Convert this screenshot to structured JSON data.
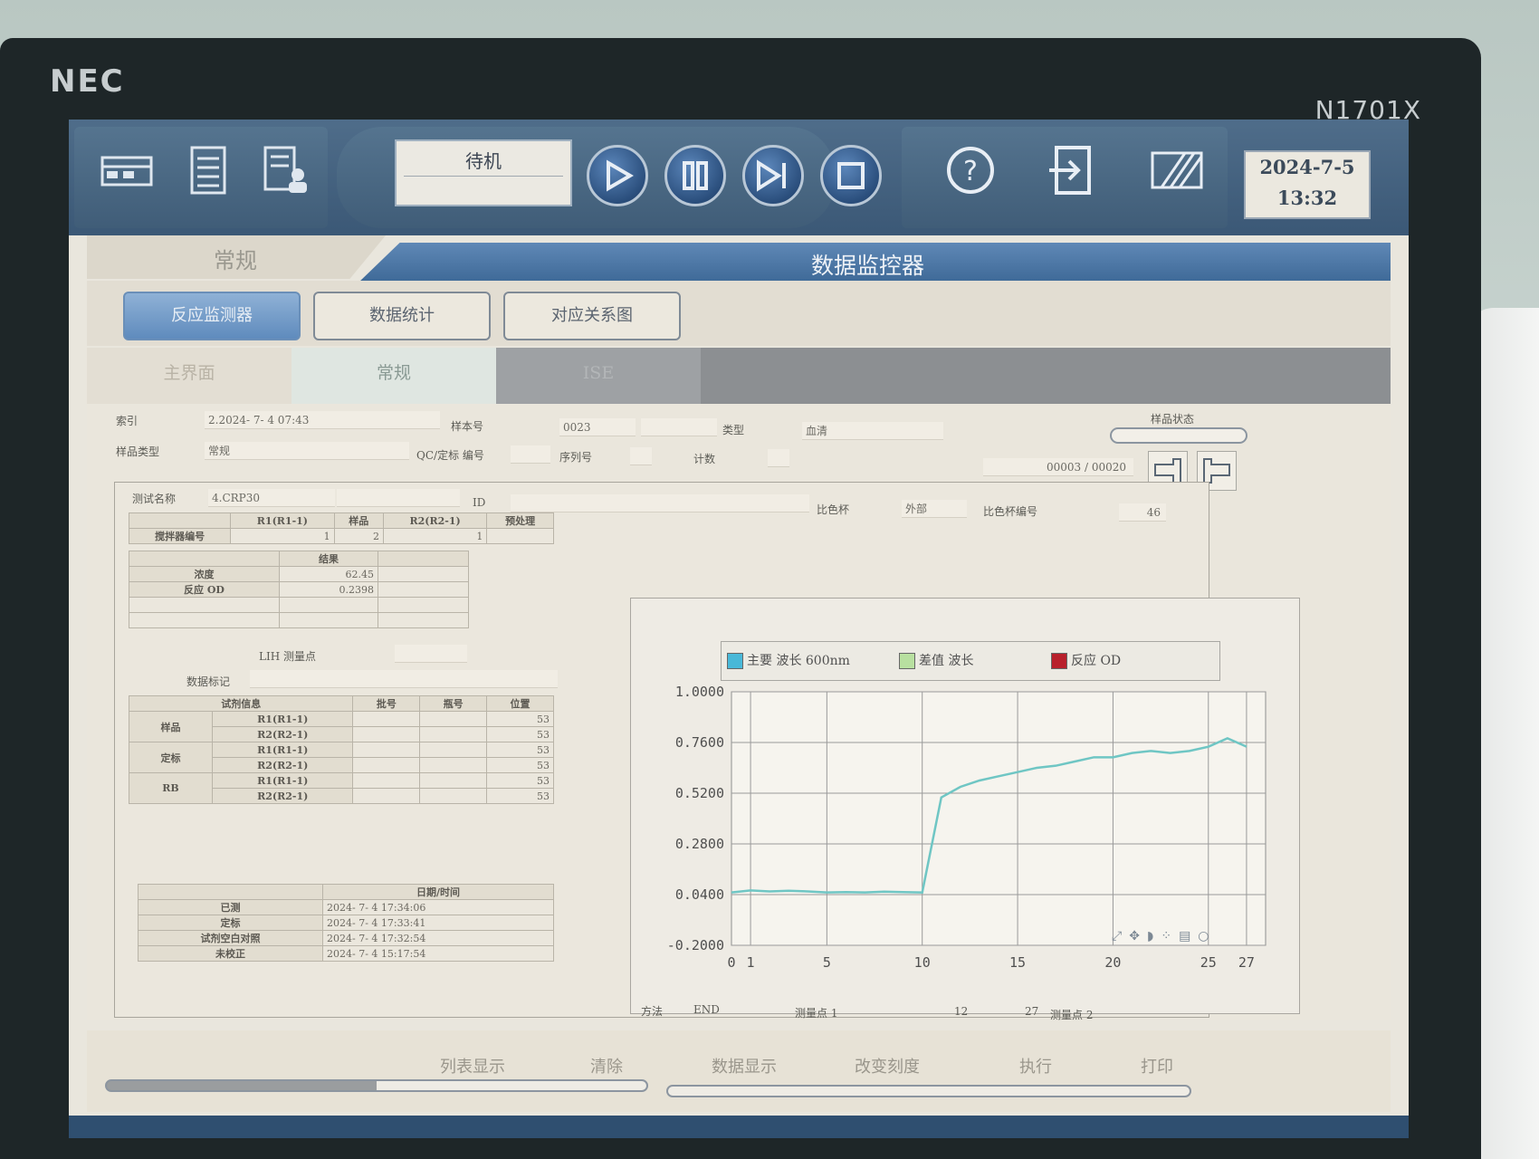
{
  "monitor": {
    "brand": "NEC",
    "model": "N1701X"
  },
  "toolbar": {
    "status": "待机",
    "date": "2024-7-5",
    "time": "13:32"
  },
  "header": {
    "left_title": "常规",
    "right_title": "数据监控器"
  },
  "tabs_row1": [
    "反应监测器",
    "数据统计",
    "对应关系图"
  ],
  "tabs_row2": [
    "主界面",
    "常规",
    "ISE"
  ],
  "sample": {
    "index_label": "索引",
    "index_value": "2.2024- 7- 4 07:43",
    "sample_no_label": "样本号",
    "sample_no_value": "0023",
    "type_label": "类型",
    "type_value": "血清",
    "sample_type_label": "样品类型",
    "sample_type_value": "常规",
    "qc_label": "QC/定标 编号",
    "seq_label": "序列号",
    "count_label": "计数",
    "page_value": "00003 / 00020",
    "status_label": "样品状态"
  },
  "test": {
    "name_label": "测试名称",
    "name_value": "4.CRP30",
    "id_label": "ID",
    "cup_label": "比色杯",
    "cup_value": "外部",
    "cup_no_label": "比色杯编号",
    "cup_no_value": "46"
  },
  "stirrer_table": {
    "headers": [
      "",
      "R1(R1-1)",
      "样品",
      "R2(R2-1)",
      "预处理"
    ],
    "row_label": "搅拌器编号",
    "values": [
      "1",
      "2",
      "1",
      ""
    ]
  },
  "result_table": {
    "header": "结果",
    "rows": [
      {
        "label": "浓度",
        "value": "62.45"
      },
      {
        "label": "反应 OD",
        "value": "0.2398"
      }
    ]
  },
  "lih_label": "LIH 测量点",
  "data_mark_label": "数据标记",
  "reagent_table": {
    "headers": [
      "试剂信息",
      "批号",
      "瓶号",
      "位置"
    ],
    "groups": [
      {
        "name": "样品",
        "rows": [
          {
            "r": "R1(R1-1)",
            "pos": "53"
          },
          {
            "r": "R2(R2-1)",
            "pos": "53"
          }
        ]
      },
      {
        "name": "定标",
        "rows": [
          {
            "r": "R1(R1-1)",
            "pos": "53"
          },
          {
            "r": "R2(R2-1)",
            "pos": "53"
          }
        ]
      },
      {
        "name": "RB",
        "rows": [
          {
            "r": "R1(R1-1)",
            "pos": "53"
          },
          {
            "r": "R2(R2-1)",
            "pos": "53"
          }
        ]
      }
    ]
  },
  "datetime_table": {
    "header": "日期/时间",
    "rows": [
      {
        "label": "已测",
        "value": "2024- 7- 4 17:34:06"
      },
      {
        "label": "定标",
        "value": "2024- 7- 4 17:33:41"
      },
      {
        "label": "试剂空白对照",
        "value": "2024- 7- 4 17:32:54"
      },
      {
        "label": "未校正",
        "value": "2024- 7- 4 15:17:54"
      }
    ]
  },
  "chart_footer": {
    "method_label": "方法",
    "method_value": "END",
    "point1_label": "测量点 1",
    "point1_value": "12",
    "point2_value": "27",
    "point2_label": "测量点 2"
  },
  "chart_data": {
    "type": "line",
    "legend": [
      {
        "name": "主要 波长 600nm",
        "color": "#49b8d8"
      },
      {
        "name": "差值 波长",
        "color": "#b8e0a0"
      },
      {
        "name": "反应 OD",
        "color": "#b8202c"
      }
    ],
    "ylim": [
      -0.2,
      1.0
    ],
    "yticks": [
      "1.0000",
      "0.7600",
      "0.5200",
      "0.2800",
      "0.0400",
      "-0.2000"
    ],
    "xlim": [
      0,
      28
    ],
    "xticks": [
      "0",
      "1",
      "5",
      "10",
      "15",
      "20",
      "25",
      "27"
    ],
    "series": [
      {
        "name": "主要 波长 600nm",
        "color": "#6fc6c4",
        "x": [
          0,
          1,
          2,
          3,
          4,
          5,
          6,
          7,
          8,
          9,
          10,
          11,
          12,
          13,
          14,
          15,
          16,
          17,
          18,
          19,
          20,
          21,
          22,
          23,
          24,
          25,
          26,
          27
        ],
        "y": [
          0.05,
          0.06,
          0.055,
          0.058,
          0.055,
          0.05,
          0.052,
          0.05,
          0.054,
          0.052,
          0.05,
          0.5,
          0.55,
          0.58,
          0.6,
          0.62,
          0.64,
          0.65,
          0.67,
          0.69,
          0.69,
          0.71,
          0.72,
          0.71,
          0.72,
          0.74,
          0.78,
          0.74
        ]
      }
    ],
    "grid": true
  },
  "bottom_actions": [
    "列表显示",
    "清除",
    "数据显示",
    "改变刻度",
    "执行",
    "打印"
  ]
}
